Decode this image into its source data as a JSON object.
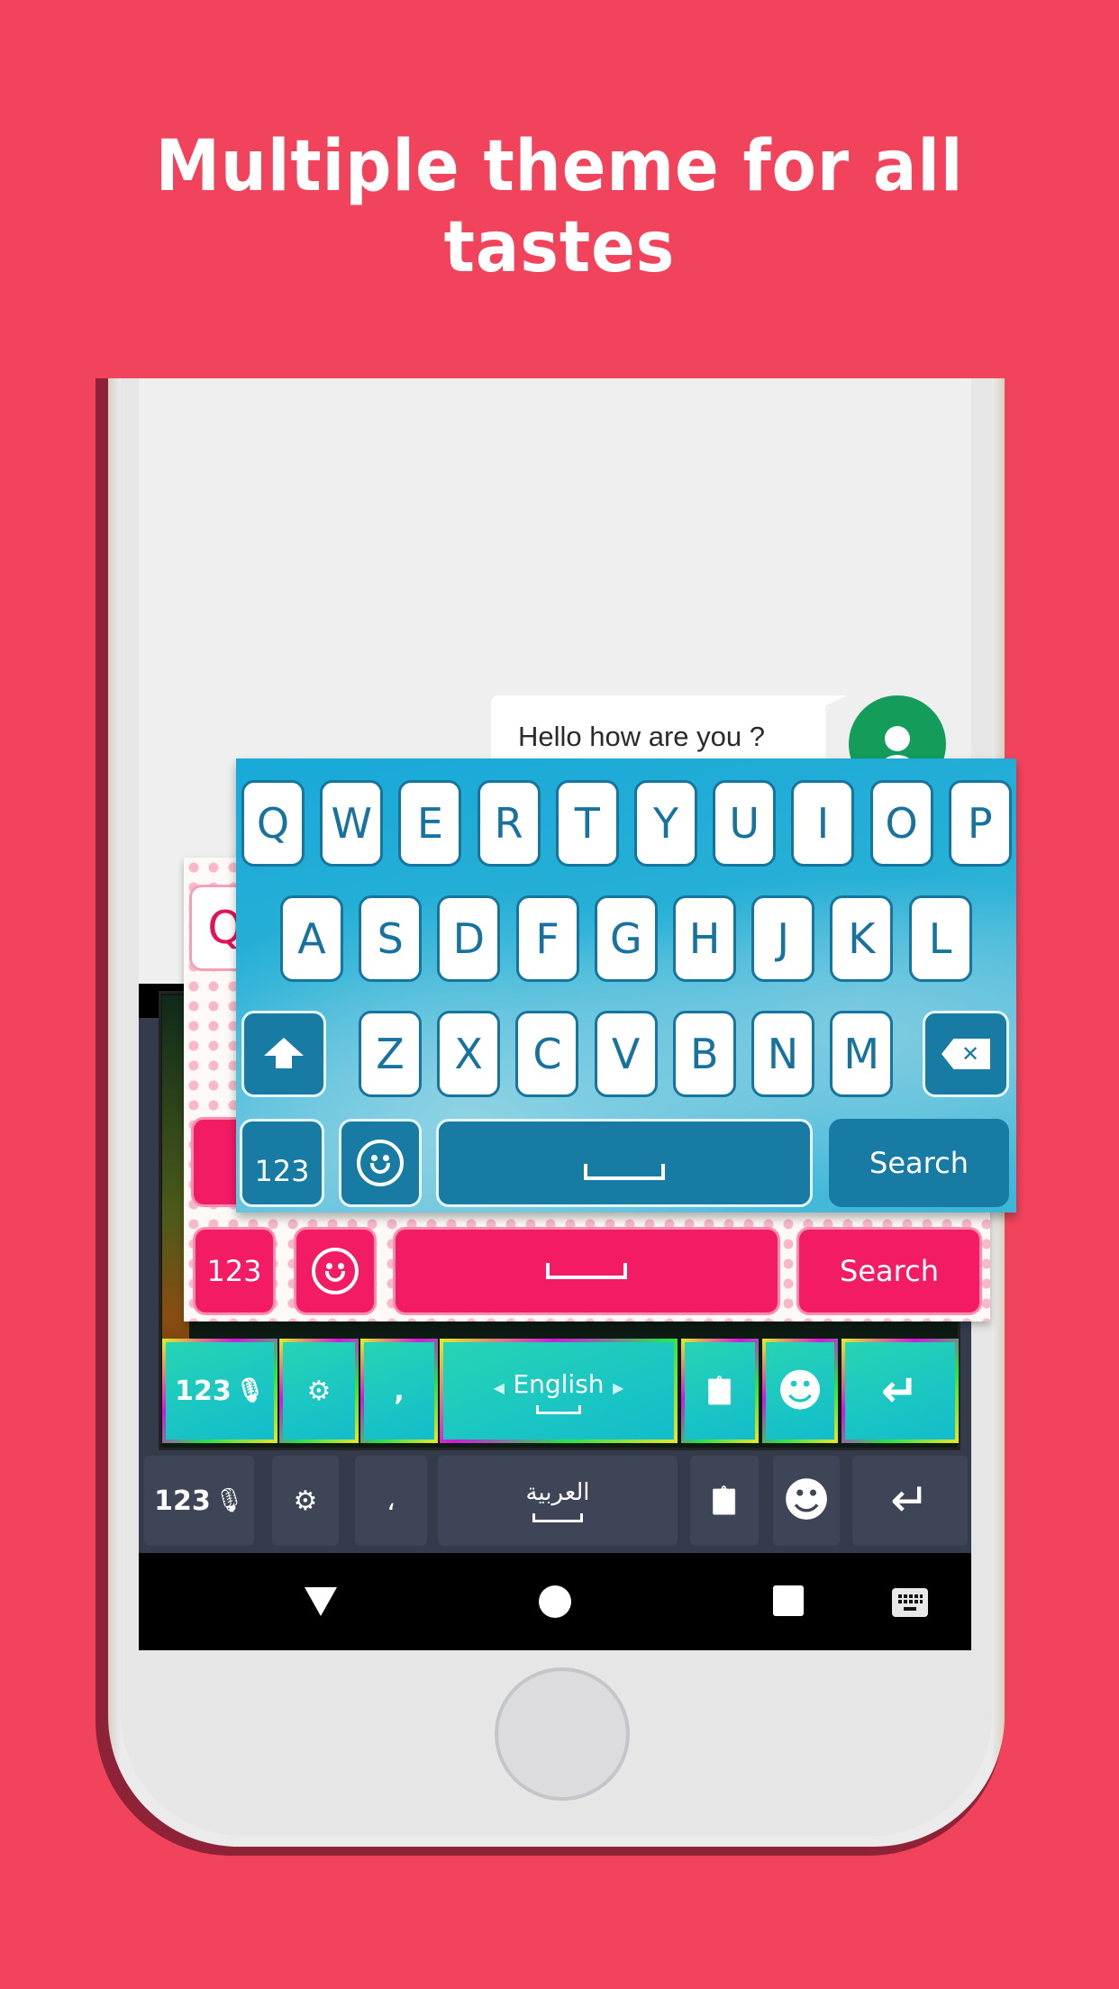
{
  "headline": "Multiple theme for all tastes",
  "colors": {
    "background": "#f2435d",
    "blue_key_text": "#17739e",
    "pink_accent": "#f21b64",
    "neon_key": "#12bccd",
    "dark_key": "#3d4556",
    "avatar": "#139c5a"
  },
  "chat": {
    "message": "Hello how are you ?",
    "avatar_icon": "person-icon"
  },
  "blue_keyboard": {
    "row1": [
      "Q",
      "W",
      "E",
      "R",
      "T",
      "Y",
      "U",
      "I",
      "O",
      "P"
    ],
    "row2": [
      "A",
      "S",
      "D",
      "F",
      "G",
      "H",
      "J",
      "K",
      "L"
    ],
    "row3": [
      "Z",
      "X",
      "C",
      "V",
      "B",
      "N",
      "M"
    ],
    "shift_icon": "shift-arrow-icon",
    "backspace_icon": "backspace-icon",
    "backspace_glyph": "✕",
    "numbers_label": "123",
    "emoji_icon": "smiley-icon",
    "space_icon": "space-bar-icon",
    "action_label": "Search"
  },
  "pink_keyboard": {
    "visible_letter": "Q",
    "numbers_label": "123",
    "emoji_icon": "smiley-icon",
    "action_label": "Search"
  },
  "neon_keyboard": {
    "numbers_label": "123",
    "settings_glyph": "⚙",
    "comma": ",",
    "language_label": "English",
    "lang_prev": "◀",
    "lang_next": "▶",
    "clipboard_glyph": "📋",
    "emoji_glyph": "☻",
    "enter_glyph": "↵"
  },
  "dark_keyboard": {
    "numbers_label": "123",
    "settings_glyph": "⚙",
    "comma": "،",
    "language_label": "العربية",
    "clipboard_glyph": "📋",
    "emoji_glyph": "☻",
    "enter_glyph": "↵"
  },
  "nav_bar": {
    "back_icon": "back-triangle-icon",
    "home_icon": "home-circle-icon",
    "recents_icon": "recents-square-icon",
    "keyboard_icon": "keyboard-switch-icon"
  }
}
